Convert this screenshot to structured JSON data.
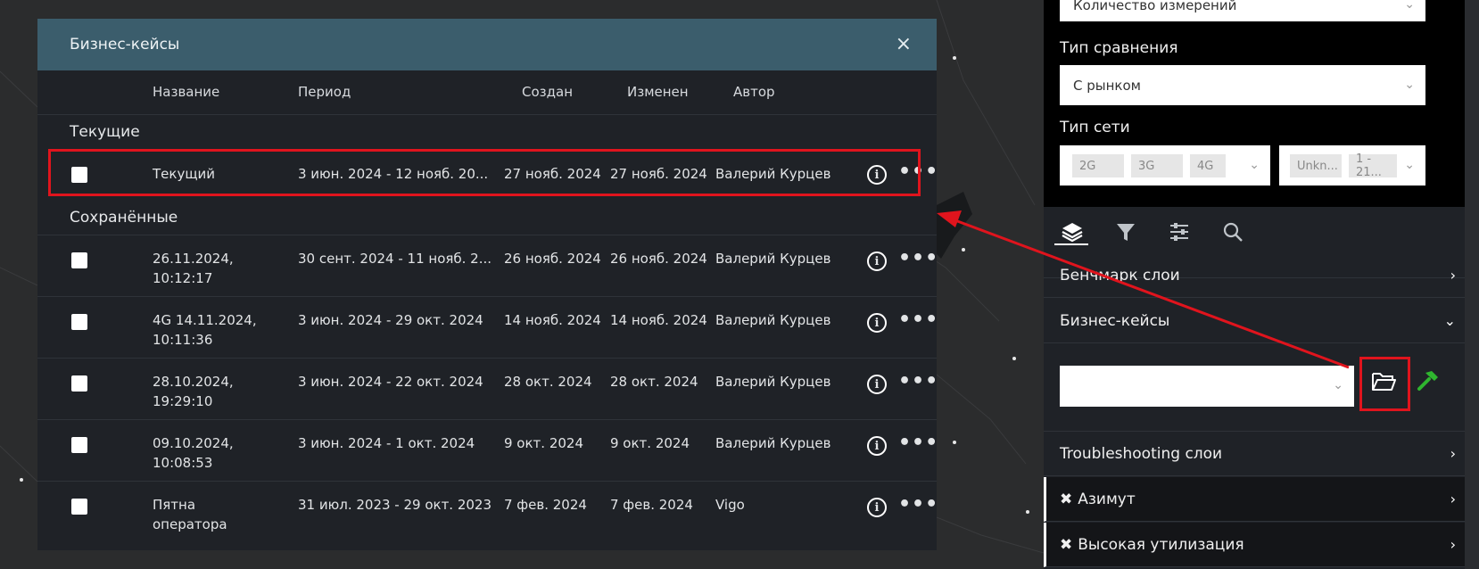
{
  "modal": {
    "title": "Бизнес-кейсы",
    "close": "×",
    "columns": {
      "name": "Название",
      "period": "Период",
      "created": "Создан",
      "changed": "Изменен",
      "author": "Автор"
    },
    "sections": {
      "current": "Текущие",
      "saved": "Сохранённые"
    },
    "current_row": {
      "name": "Текущий",
      "period": "3 июн. 2024 - 12 нояб. 20...",
      "created": "27 нояб. 2024",
      "changed": "27 нояб. 2024",
      "author": "Валерий Курцев"
    },
    "saved_rows": [
      {
        "name1": "26.11.2024,",
        "name2": "10:12:17",
        "period": "30 сент. 2024 - 11 нояб. 2...",
        "created": "26 нояб. 2024",
        "changed": "26 нояб. 2024",
        "author": "Валерий Курцев"
      },
      {
        "name1": "4G 14.11.2024,",
        "name2": "10:11:36",
        "period": "3 июн. 2024 - 29 окт. 2024",
        "created": "14 нояб. 2024",
        "changed": "14 нояб. 2024",
        "author": "Валерий Курцев"
      },
      {
        "name1": "28.10.2024,",
        "name2": "19:29:10",
        "period": "3 июн. 2024 - 22 окт. 2024",
        "created": "28 окт. 2024",
        "changed": "28 окт. 2024",
        "author": "Валерий Курцев"
      },
      {
        "name1": "09.10.2024,",
        "name2": "10:08:53",
        "period": "3 июн. 2024 - 1 окт. 2024",
        "created": "9 окт. 2024",
        "changed": "9 окт. 2024",
        "author": "Валерий Курцев"
      },
      {
        "name1": "Пятна",
        "name2": "оператора",
        "period": "31 июл. 2023 - 29 окт. 2023",
        "created": "7 фев. 2024",
        "changed": "7 фев. 2024",
        "author": "Vigo"
      }
    ],
    "info_glyph": "i",
    "more_glyph": "•••"
  },
  "panel": {
    "top_select": "Количество измерений",
    "compare_label": "Тип сравнения",
    "compare_value": "С рынком",
    "network_label": "Тип сети",
    "chips_left": [
      "2G",
      "3G",
      "4G"
    ],
    "chips_right": [
      "Unkn...",
      "1 - 21..."
    ],
    "rows": {
      "benchmark": "Бенчмарк слои",
      "business": "Бизнес-кейсы",
      "troubleshooting": "Troubleshooting слои",
      "azimuth": "Азимут",
      "utilization": "Высокая утилизация"
    },
    "business_select": "",
    "chevron_right": "›",
    "chevron_down": "⌄",
    "tool_glyph": "✖"
  },
  "colors": {
    "accent_red": "#e0141d",
    "header_teal": "#3b5d6c",
    "build_green": "#2fb52f"
  }
}
